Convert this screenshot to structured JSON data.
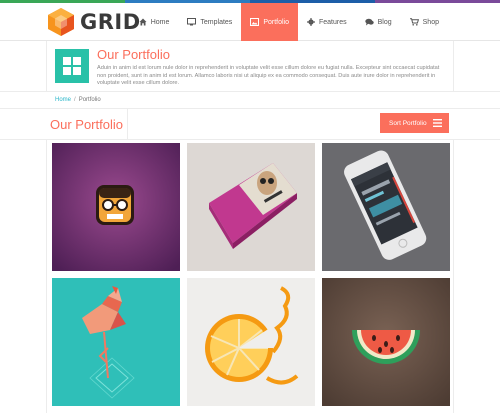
{
  "brand": {
    "name": "GRID",
    "colors": {
      "accent": "#fb6f5c",
      "teal": "#29c1a8",
      "link": "#29b6c9"
    }
  },
  "topbar_colors": [
    "#3aa757",
    "#2d7cc1",
    "#1d5ea8",
    "#7a4a9a"
  ],
  "nav": {
    "items": [
      {
        "label": "Home",
        "icon": "home-icon"
      },
      {
        "label": "Templates",
        "icon": "monitor-icon"
      },
      {
        "label": "Portfolio",
        "icon": "image-icon"
      },
      {
        "label": "Features",
        "icon": "gear-icon"
      },
      {
        "label": "Blog",
        "icon": "comments-icon"
      },
      {
        "label": "Shop",
        "icon": "cart-icon"
      }
    ],
    "active": "Portfolio"
  },
  "intro": {
    "title": "Our Portfolio",
    "icon": "grid-icon",
    "text": "Aduin in anim id est lorum nule dolor in reprehenderit in voluptate velit esse cillum dolore eu fugiat nulla. Excepteur sint occaecat cupidatat non proident, sunt in anim id est lorum. Allamco laboris nisi ut aliquip ex ea commodo consequat. Duis aute irure dolor in reprehenderit in voluptate velit esse cillum dolore."
  },
  "breadcrumb": {
    "home": "Home",
    "separator": "/",
    "current": "Portfolio"
  },
  "section": {
    "title": "Our Portfolio",
    "sort_label": "Sort Portfolio",
    "sort_icon": "menu-icon"
  },
  "portfolio": [
    {
      "name": "geek-app-icon",
      "bg": "#6b2c6e"
    },
    {
      "name": "book-mockup",
      "bg": "#ddd8d4"
    },
    {
      "name": "iphone-mockup",
      "bg": "#6a6a6e"
    },
    {
      "name": "flamingo",
      "bg": "#2fbfb8"
    },
    {
      "name": "orange-peel",
      "bg": "#efeeec"
    },
    {
      "name": "watermelon-icon",
      "bg": "#5d4a40"
    }
  ]
}
